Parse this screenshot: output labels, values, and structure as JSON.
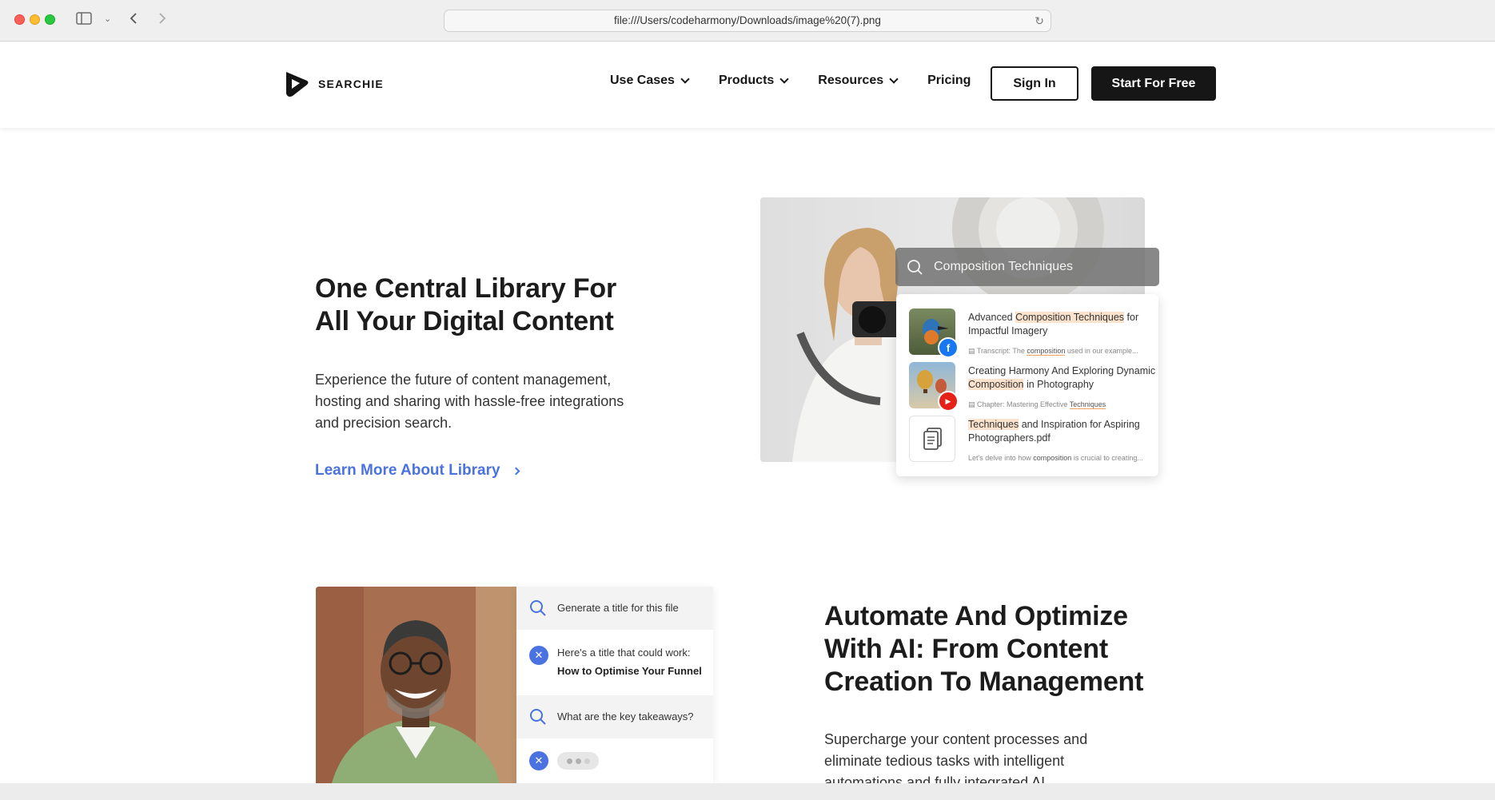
{
  "browser": {
    "url": "file:///Users/codeharmony/Downloads/image%20(7).png"
  },
  "header": {
    "logo_text": "SEARCHIE",
    "nav": [
      {
        "label": "Use Cases"
      },
      {
        "label": "Products"
      },
      {
        "label": "Resources"
      },
      {
        "label": "Pricing"
      }
    ],
    "sign_in": "Sign In",
    "start_free": "Start For Free"
  },
  "library": {
    "title_line1": "One Central Library For",
    "title_line2": "All Your Digital Content",
    "description": "Experience the future of content management, hosting and sharing with hassle-free integrations and precision search.",
    "link_label": "Learn More About Library",
    "search_query": "Composition Techniques",
    "results": [
      {
        "title_pre": "Advanced ",
        "title_hl": "Composition Techniques",
        "title_post": " for Impactful Imagery",
        "sub_pre": "Transcript:  The ",
        "sub_ul": "composition",
        "sub_post": " used in our example...",
        "badge": "f",
        "badge_color": "#1877f2"
      },
      {
        "title_pre": "Creating Harmony And Exploring Dynamic ",
        "title_hl": "Composition",
        "title_post": " in Photography",
        "sub_pre": "Chapter: Mastering Effective ",
        "sub_ul": "Techniques",
        "sub_post": "",
        "badge": "▶",
        "badge_color": "#e62117"
      },
      {
        "title_pre": "",
        "title_hl": "Techniques",
        "title_post": " and Inspiration for Aspiring Photographers.pdf",
        "sub_pre": "Let's delve into how ",
        "sub_ul": "composition",
        "sub_post": " is crucial to creating..."
      }
    ]
  },
  "ai": {
    "title_line1": "Automate And Optimize",
    "title_line2": "With AI: From Content",
    "title_line3": "Creation To Management",
    "description": "Supercharge your content processes and eliminate tedious tasks with intelligent automations and fully integrated AI",
    "chat": [
      {
        "type": "question",
        "text": "Generate a title for this file"
      },
      {
        "type": "answer",
        "line1": "Here's a title that could work:",
        "line2": "How to Optimise Your Funnel"
      },
      {
        "type": "question",
        "text": "What are the key takeaways?"
      }
    ]
  },
  "colors": {
    "accent": "#4a72e0",
    "dark": "#161616",
    "highlight": "#fbe2cc"
  }
}
